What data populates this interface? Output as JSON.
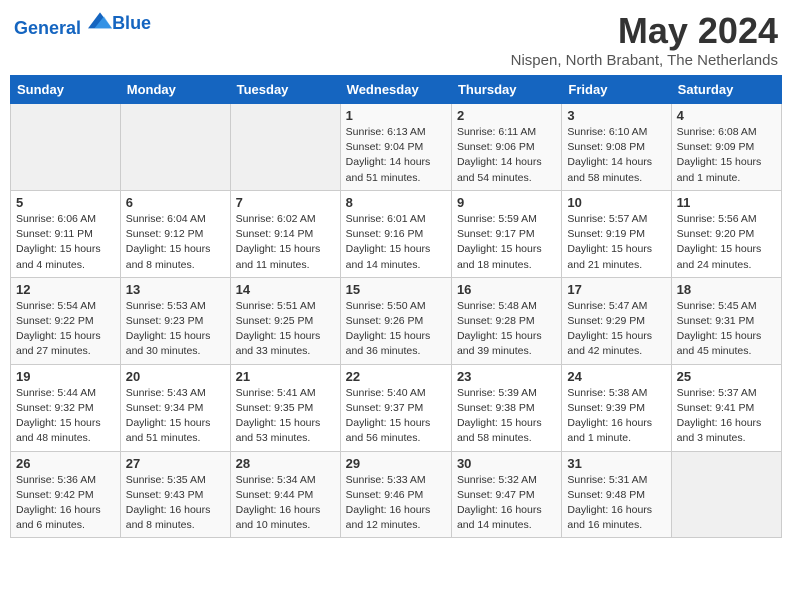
{
  "header": {
    "logo_line1": "General",
    "logo_line2": "Blue",
    "month_title": "May 2024",
    "subtitle": "Nispen, North Brabant, The Netherlands"
  },
  "days_of_week": [
    "Sunday",
    "Monday",
    "Tuesday",
    "Wednesday",
    "Thursday",
    "Friday",
    "Saturday"
  ],
  "weeks": [
    [
      {
        "day": "",
        "info": ""
      },
      {
        "day": "",
        "info": ""
      },
      {
        "day": "",
        "info": ""
      },
      {
        "day": "1",
        "info": "Sunrise: 6:13 AM\nSunset: 9:04 PM\nDaylight: 14 hours and 51 minutes."
      },
      {
        "day": "2",
        "info": "Sunrise: 6:11 AM\nSunset: 9:06 PM\nDaylight: 14 hours and 54 minutes."
      },
      {
        "day": "3",
        "info": "Sunrise: 6:10 AM\nSunset: 9:08 PM\nDaylight: 14 hours and 58 minutes."
      },
      {
        "day": "4",
        "info": "Sunrise: 6:08 AM\nSunset: 9:09 PM\nDaylight: 15 hours and 1 minute."
      }
    ],
    [
      {
        "day": "5",
        "info": "Sunrise: 6:06 AM\nSunset: 9:11 PM\nDaylight: 15 hours and 4 minutes."
      },
      {
        "day": "6",
        "info": "Sunrise: 6:04 AM\nSunset: 9:12 PM\nDaylight: 15 hours and 8 minutes."
      },
      {
        "day": "7",
        "info": "Sunrise: 6:02 AM\nSunset: 9:14 PM\nDaylight: 15 hours and 11 minutes."
      },
      {
        "day": "8",
        "info": "Sunrise: 6:01 AM\nSunset: 9:16 PM\nDaylight: 15 hours and 14 minutes."
      },
      {
        "day": "9",
        "info": "Sunrise: 5:59 AM\nSunset: 9:17 PM\nDaylight: 15 hours and 18 minutes."
      },
      {
        "day": "10",
        "info": "Sunrise: 5:57 AM\nSunset: 9:19 PM\nDaylight: 15 hours and 21 minutes."
      },
      {
        "day": "11",
        "info": "Sunrise: 5:56 AM\nSunset: 9:20 PM\nDaylight: 15 hours and 24 minutes."
      }
    ],
    [
      {
        "day": "12",
        "info": "Sunrise: 5:54 AM\nSunset: 9:22 PM\nDaylight: 15 hours and 27 minutes."
      },
      {
        "day": "13",
        "info": "Sunrise: 5:53 AM\nSunset: 9:23 PM\nDaylight: 15 hours and 30 minutes."
      },
      {
        "day": "14",
        "info": "Sunrise: 5:51 AM\nSunset: 9:25 PM\nDaylight: 15 hours and 33 minutes."
      },
      {
        "day": "15",
        "info": "Sunrise: 5:50 AM\nSunset: 9:26 PM\nDaylight: 15 hours and 36 minutes."
      },
      {
        "day": "16",
        "info": "Sunrise: 5:48 AM\nSunset: 9:28 PM\nDaylight: 15 hours and 39 minutes."
      },
      {
        "day": "17",
        "info": "Sunrise: 5:47 AM\nSunset: 9:29 PM\nDaylight: 15 hours and 42 minutes."
      },
      {
        "day": "18",
        "info": "Sunrise: 5:45 AM\nSunset: 9:31 PM\nDaylight: 15 hours and 45 minutes."
      }
    ],
    [
      {
        "day": "19",
        "info": "Sunrise: 5:44 AM\nSunset: 9:32 PM\nDaylight: 15 hours and 48 minutes."
      },
      {
        "day": "20",
        "info": "Sunrise: 5:43 AM\nSunset: 9:34 PM\nDaylight: 15 hours and 51 minutes."
      },
      {
        "day": "21",
        "info": "Sunrise: 5:41 AM\nSunset: 9:35 PM\nDaylight: 15 hours and 53 minutes."
      },
      {
        "day": "22",
        "info": "Sunrise: 5:40 AM\nSunset: 9:37 PM\nDaylight: 15 hours and 56 minutes."
      },
      {
        "day": "23",
        "info": "Sunrise: 5:39 AM\nSunset: 9:38 PM\nDaylight: 15 hours and 58 minutes."
      },
      {
        "day": "24",
        "info": "Sunrise: 5:38 AM\nSunset: 9:39 PM\nDaylight: 16 hours and 1 minute."
      },
      {
        "day": "25",
        "info": "Sunrise: 5:37 AM\nSunset: 9:41 PM\nDaylight: 16 hours and 3 minutes."
      }
    ],
    [
      {
        "day": "26",
        "info": "Sunrise: 5:36 AM\nSunset: 9:42 PM\nDaylight: 16 hours and 6 minutes."
      },
      {
        "day": "27",
        "info": "Sunrise: 5:35 AM\nSunset: 9:43 PM\nDaylight: 16 hours and 8 minutes."
      },
      {
        "day": "28",
        "info": "Sunrise: 5:34 AM\nSunset: 9:44 PM\nDaylight: 16 hours and 10 minutes."
      },
      {
        "day": "29",
        "info": "Sunrise: 5:33 AM\nSunset: 9:46 PM\nDaylight: 16 hours and 12 minutes."
      },
      {
        "day": "30",
        "info": "Sunrise: 5:32 AM\nSunset: 9:47 PM\nDaylight: 16 hours and 14 minutes."
      },
      {
        "day": "31",
        "info": "Sunrise: 5:31 AM\nSunset: 9:48 PM\nDaylight: 16 hours and 16 minutes."
      },
      {
        "day": "",
        "info": ""
      }
    ]
  ]
}
